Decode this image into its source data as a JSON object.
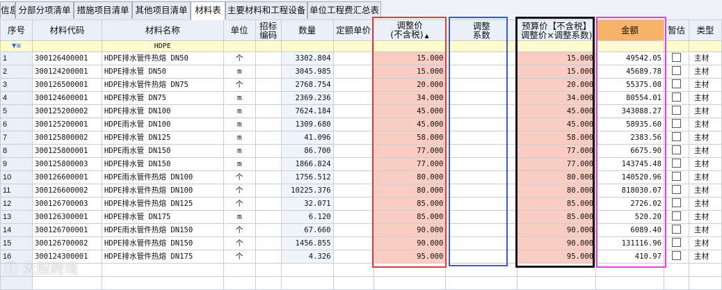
{
  "tabs": [
    {
      "label": "信息"
    },
    {
      "label": "分部分项清单"
    },
    {
      "label": "措施项目清单"
    },
    {
      "label": "其他项目清单"
    },
    {
      "label": "材料表"
    },
    {
      "label": "主要材料和工程设备"
    },
    {
      "label": "单位工程费汇总表"
    }
  ],
  "active_tab": "材料表",
  "columns": {
    "seq": "序号",
    "code": "材料代码",
    "name": "材料名称",
    "unit": "单位",
    "bid_code_l1": "招标",
    "bid_code_l2": "编码",
    "qty": "数量",
    "quota_price": "定额单价",
    "adj_price_l1": "调整价",
    "adj_price_l2": "(不含税)",
    "adj_coef_l1": "调整",
    "adj_coef_l2": "系数",
    "budget_l1": "预算价【不含税】",
    "budget_l2": "调整价×调整系数)",
    "amount": "金额",
    "provisional": "暂估",
    "type": "类型"
  },
  "filter": {
    "name": "HDPE"
  },
  "rows": [
    {
      "seq": "1",
      "code": "300126400001",
      "name": "HDPE排水管件热熔 DN50",
      "unit": "个",
      "qty": "3302.804",
      "adj": "15.000",
      "budget": "15.000",
      "amount": "49542.05",
      "type": "主材"
    },
    {
      "seq": "2",
      "code": "300124200001",
      "name": "HDPE排水管 DN50",
      "unit": "m",
      "qty": "3045.985",
      "adj": "15.000",
      "budget": "15.000",
      "amount": "45689.78",
      "type": "主材"
    },
    {
      "seq": "3",
      "code": "300126500001",
      "name": "HDPE排水管件热熔 DN75",
      "unit": "个",
      "qty": "2768.754",
      "adj": "20.000",
      "budget": "20.000",
      "amount": "55375.08",
      "type": "主材"
    },
    {
      "seq": "4",
      "code": "300124600001",
      "name": "HDPE排水管 DN75",
      "unit": "m",
      "qty": "2369.236",
      "adj": "34.000",
      "budget": "34.000",
      "amount": "80554.01",
      "type": "主材"
    },
    {
      "seq": "5",
      "code": "300125200002",
      "name": "HDPE排水管 DN100",
      "unit": "m",
      "qty": "7624.184",
      "adj": "45.000",
      "budget": "45.000",
      "amount": "343088.27",
      "type": "主材"
    },
    {
      "seq": "6",
      "code": "300125200001",
      "name": "HDPE雨水管 DN100",
      "unit": "m",
      "qty": "1309.680",
      "adj": "45.000",
      "budget": "45.000",
      "amount": "58935.60",
      "type": "主材"
    },
    {
      "seq": "7",
      "code": "300125800002",
      "name": "HDPE排水管 DN125",
      "unit": "m",
      "qty": "41.096",
      "adj": "58.000",
      "budget": "58.000",
      "amount": "2383.56",
      "type": "主材"
    },
    {
      "seq": "8",
      "code": "300125800001",
      "name": "HDPE雨水管 DN150",
      "unit": "m",
      "qty": "86.700",
      "adj": "77.000",
      "budget": "77.000",
      "amount": "6675.90",
      "type": "主材"
    },
    {
      "seq": "9",
      "code": "300125800003",
      "name": "HDPE排水管 DN150",
      "unit": "m",
      "qty": "1866.824",
      "adj": "77.000",
      "budget": "77.000",
      "amount": "143745.48",
      "type": "主材"
    },
    {
      "seq": "10",
      "code": "300126600001",
      "name": "HDPE雨水管件热熔 DN100",
      "unit": "个",
      "qty": "1756.512",
      "adj": "80.000",
      "budget": "80.000",
      "amount": "140520.96",
      "type": "主材"
    },
    {
      "seq": "11",
      "code": "300126600002",
      "name": "HDPE排水管件热熔 DN100",
      "unit": "个",
      "qty": "10225.376",
      "adj": "80.000",
      "budget": "80.000",
      "amount": "818030.07",
      "type": "主材"
    },
    {
      "seq": "12",
      "code": "300126700003",
      "name": "HDPE排水管件热熔 DN125",
      "unit": "个",
      "qty": "32.071",
      "adj": "85.000",
      "budget": "85.000",
      "amount": "2726.02",
      "type": "主材"
    },
    {
      "seq": "13",
      "code": "300126300001",
      "name": "HDPE排水管 DN175",
      "unit": "m",
      "qty": "6.120",
      "adj": "85.000",
      "budget": "85.000",
      "amount": "520.20",
      "type": "主材"
    },
    {
      "seq": "14",
      "code": "300126700001",
      "name": "HDPE雨水管件热熔 DN150",
      "unit": "个",
      "qty": "67.660",
      "adj": "90.000",
      "budget": "90.000",
      "amount": "6089.40",
      "type": "主材"
    },
    {
      "seq": "15",
      "code": "300126700002",
      "name": "HDPE排水管件热熔 DN150",
      "unit": "个",
      "qty": "1456.855",
      "adj": "90.000",
      "budget": "90.000",
      "amount": "131116.96",
      "type": "主材"
    },
    {
      "seq": "16",
      "code": "300124300001",
      "name": "HDPE排水管件热熔 DN175",
      "unit": "个",
      "qty": "4.326",
      "adj": "95.000",
      "budget": "95.000",
      "amount": "410.97",
      "type": "主材"
    }
  ],
  "highlight_colors": {
    "adjust_price": "#e53935",
    "adjust_coef": "#3a5bb8",
    "budget_price": "#111111",
    "amount": "#e040e0"
  },
  "watermark": "大股跨境"
}
